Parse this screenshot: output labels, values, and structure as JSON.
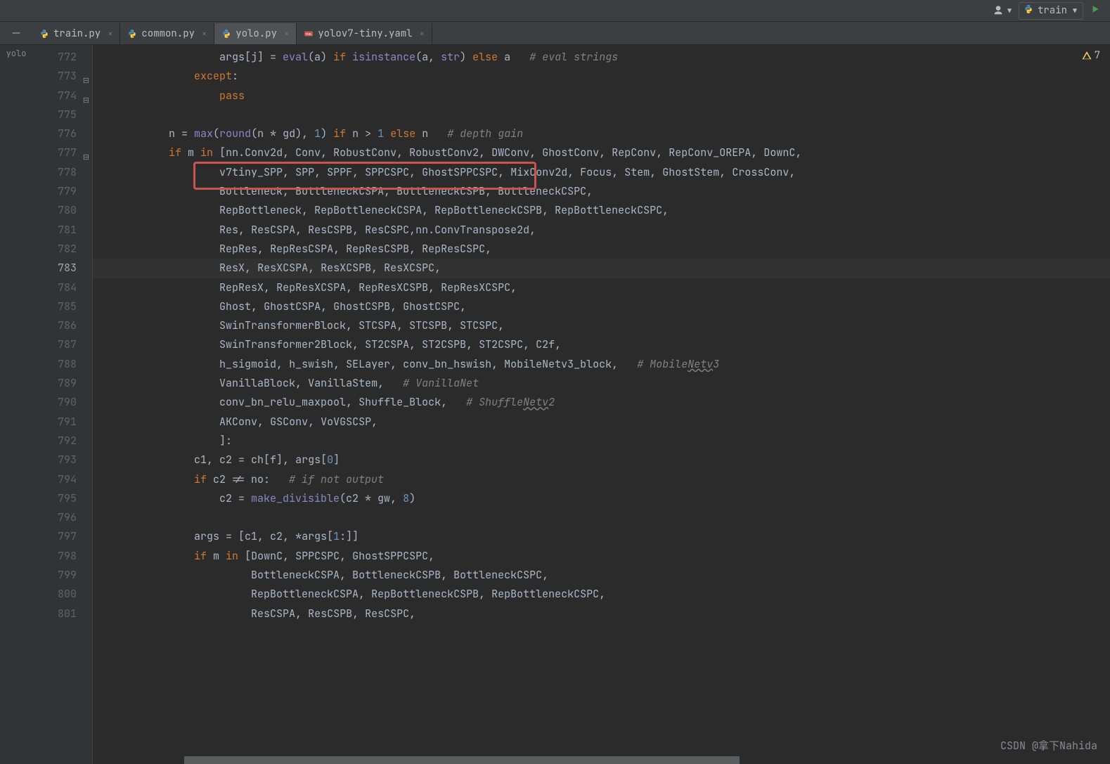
{
  "toolbar": {
    "run_config": "train"
  },
  "tabs": [
    {
      "name": "train.py",
      "icon": "py",
      "active": false
    },
    {
      "name": "common.py",
      "icon": "py",
      "active": false
    },
    {
      "name": "yolo.py",
      "icon": "py",
      "active": true
    },
    {
      "name": "yolov7-tiny.yaml",
      "icon": "yml",
      "active": false
    }
  ],
  "left_label": "yolo",
  "problems_count": "7",
  "watermark": "CSDN @拿下Nahida",
  "lines": [
    {
      "num": 772,
      "indent": 20,
      "spans": [
        [
          "gl",
          "args[j] = "
        ],
        [
          "bi",
          "eval"
        ],
        [
          "pn",
          "(a) "
        ],
        [
          "kw",
          "if "
        ],
        [
          "bi",
          "isinstance"
        ],
        [
          "pn",
          "(a"
        ],
        [
          "op",
          ", "
        ],
        [
          "bi",
          "str"
        ],
        [
          "pn",
          ") "
        ],
        [
          "kw",
          "else"
        ],
        [
          "pn",
          " a   "
        ],
        [
          "cm",
          "# eval strings"
        ]
      ]
    },
    {
      "num": 773,
      "indent": 16,
      "fold": "▾",
      "spans": [
        [
          "kw",
          "except"
        ],
        [
          "pn",
          ":"
        ]
      ]
    },
    {
      "num": 774,
      "indent": 20,
      "fold": "▴",
      "spans": [
        [
          "kw",
          "pass"
        ]
      ]
    },
    {
      "num": 775,
      "indent": 0,
      "spans": []
    },
    {
      "num": 776,
      "indent": 12,
      "spans": [
        [
          "gl",
          "n = "
        ],
        [
          "bi",
          "max"
        ],
        [
          "pn",
          "("
        ],
        [
          "bi",
          "round"
        ],
        [
          "pn",
          "(n * gd)"
        ],
        [
          "op",
          ", "
        ],
        [
          "nm",
          "1"
        ],
        [
          "pn",
          ") "
        ],
        [
          "kw",
          "if"
        ],
        [
          "pn",
          " n > "
        ],
        [
          "nm",
          "1"
        ],
        [
          "pn",
          " "
        ],
        [
          "kw",
          "else"
        ],
        [
          "pn",
          " n   "
        ],
        [
          "cm",
          "# depth gain"
        ]
      ]
    },
    {
      "num": 777,
      "indent": 12,
      "fold": "▾",
      "spans": [
        [
          "kw",
          "if"
        ],
        [
          "pn",
          " m "
        ],
        [
          "kw",
          "in"
        ],
        [
          "pn",
          " [nn.Conv2d"
        ],
        [
          "op",
          ", "
        ],
        [
          "cl",
          "Conv"
        ],
        [
          "op",
          ", "
        ],
        [
          "cl",
          "RobustConv"
        ],
        [
          "op",
          ", "
        ],
        [
          "cl",
          "RobustConv2"
        ],
        [
          "op",
          ", "
        ],
        [
          "cl",
          "DWConv"
        ],
        [
          "op",
          ", "
        ],
        [
          "cl",
          "GhostConv"
        ],
        [
          "op",
          ", "
        ],
        [
          "cl",
          "RepConv"
        ],
        [
          "op",
          ", "
        ],
        [
          "cl",
          "RepConv_OREPA"
        ],
        [
          "op",
          ", "
        ],
        [
          "cl",
          "DownC"
        ],
        [
          "op",
          ","
        ]
      ]
    },
    {
      "num": 778,
      "indent": 18,
      "spans": [
        [
          "pn",
          "  "
        ],
        [
          "cl",
          "v7tiny_SPP"
        ],
        [
          "op",
          ", "
        ],
        [
          "cl",
          "SPP"
        ],
        [
          "op",
          ", "
        ],
        [
          "cl",
          "SPPF"
        ],
        [
          "op",
          ", "
        ],
        [
          "cl",
          "SPPCSPC"
        ],
        [
          "op",
          ", "
        ],
        [
          "cl",
          "GhostSPPCSPC"
        ],
        [
          "op",
          ", "
        ],
        [
          "cl",
          "MixConv2d"
        ],
        [
          "op",
          ", "
        ],
        [
          "cl",
          "Focus"
        ],
        [
          "op",
          ", "
        ],
        [
          "cl",
          "Stem"
        ],
        [
          "op",
          ", "
        ],
        [
          "cl",
          "GhostStem"
        ],
        [
          "op",
          ", "
        ],
        [
          "cl",
          "CrossConv"
        ],
        [
          "op",
          ","
        ]
      ]
    },
    {
      "num": 779,
      "indent": 18,
      "spans": [
        [
          "pn",
          "  "
        ],
        [
          "cl",
          "Bottleneck"
        ],
        [
          "op",
          ", "
        ],
        [
          "cl",
          "BottleneckCSPA"
        ],
        [
          "op",
          ", "
        ],
        [
          "cl",
          "BottleneckCSPB"
        ],
        [
          "op",
          ", "
        ],
        [
          "cl",
          "BottleneckCSPC"
        ],
        [
          "op",
          ","
        ]
      ]
    },
    {
      "num": 780,
      "indent": 18,
      "spans": [
        [
          "pn",
          "  "
        ],
        [
          "cl",
          "RepBottleneck"
        ],
        [
          "op",
          ", "
        ],
        [
          "cl",
          "RepBottleneckCSPA"
        ],
        [
          "op",
          ", "
        ],
        [
          "cl",
          "RepBottleneckCSPB"
        ],
        [
          "op",
          ", "
        ],
        [
          "cl",
          "RepBottleneckCSPC"
        ],
        [
          "op",
          ","
        ]
      ]
    },
    {
      "num": 781,
      "indent": 18,
      "spans": [
        [
          "pn",
          "  "
        ],
        [
          "cl",
          "Res"
        ],
        [
          "op",
          ", "
        ],
        [
          "cl",
          "ResCSPA"
        ],
        [
          "op",
          ", "
        ],
        [
          "cl",
          "ResCSPB"
        ],
        [
          "op",
          ", "
        ],
        [
          "cl",
          "ResCSPC"
        ],
        [
          "op",
          ","
        ],
        [
          "cl",
          "nn.ConvTranspose2d"
        ],
        [
          "op",
          ","
        ]
      ]
    },
    {
      "num": 782,
      "indent": 18,
      "spans": [
        [
          "pn",
          "  "
        ],
        [
          "cl",
          "RepRes"
        ],
        [
          "op",
          ", "
        ],
        [
          "cl",
          "RepResCSPA"
        ],
        [
          "op",
          ", "
        ],
        [
          "cl",
          "RepResCSPB"
        ],
        [
          "op",
          ", "
        ],
        [
          "cl",
          "RepResCSPC"
        ],
        [
          "op",
          ","
        ]
      ]
    },
    {
      "num": 783,
      "indent": 18,
      "current": true,
      "bulb": true,
      "spans": [
        [
          "pn",
          "  "
        ],
        [
          "cl",
          "ResX"
        ],
        [
          "op",
          ", "
        ],
        [
          "cl",
          "ResXCSPA"
        ],
        [
          "op",
          ", "
        ],
        [
          "cl",
          "ResXCSPB"
        ],
        [
          "op",
          ", "
        ],
        [
          "cl",
          "ResXCSPC"
        ],
        [
          "op",
          ","
        ]
      ]
    },
    {
      "num": 784,
      "indent": 18,
      "spans": [
        [
          "pn",
          "  "
        ],
        [
          "cl",
          "RepResX"
        ],
        [
          "op",
          ", "
        ],
        [
          "cl",
          "RepResXCSPA"
        ],
        [
          "op",
          ", "
        ],
        [
          "cl",
          "RepResXCSPB"
        ],
        [
          "op",
          ", "
        ],
        [
          "cl",
          "RepResXCSPC"
        ],
        [
          "op",
          ","
        ]
      ]
    },
    {
      "num": 785,
      "indent": 18,
      "spans": [
        [
          "pn",
          "  "
        ],
        [
          "cl",
          "Ghost"
        ],
        [
          "op",
          ", "
        ],
        [
          "cl",
          "GhostCSPA"
        ],
        [
          "op",
          ", "
        ],
        [
          "cl",
          "GhostCSPB"
        ],
        [
          "op",
          ", "
        ],
        [
          "cl",
          "GhostCSPC"
        ],
        [
          "op",
          ","
        ]
      ]
    },
    {
      "num": 786,
      "indent": 18,
      "spans": [
        [
          "pn",
          "  "
        ],
        [
          "cl",
          "SwinTransformerBlock"
        ],
        [
          "op",
          ", "
        ],
        [
          "cl",
          "STCSPA"
        ],
        [
          "op",
          ", "
        ],
        [
          "cl",
          "STCSPB"
        ],
        [
          "op",
          ", "
        ],
        [
          "cl",
          "STCSPC"
        ],
        [
          "op",
          ","
        ]
      ]
    },
    {
      "num": 787,
      "indent": 18,
      "spans": [
        [
          "pn",
          "  "
        ],
        [
          "cl",
          "SwinTransformer2Block"
        ],
        [
          "op",
          ", "
        ],
        [
          "cl",
          "ST2CSPA"
        ],
        [
          "op",
          ", "
        ],
        [
          "cl",
          "ST2CSPB"
        ],
        [
          "op",
          ", "
        ],
        [
          "cl",
          "ST2CSPC"
        ],
        [
          "op",
          ", "
        ],
        [
          "cl",
          "C2f"
        ],
        [
          "op",
          ","
        ]
      ]
    },
    {
      "num": 788,
      "indent": 18,
      "spans": [
        [
          "pn",
          "  "
        ],
        [
          "cl",
          "h_sigmoid"
        ],
        [
          "op",
          ", "
        ],
        [
          "cl",
          "h_swish"
        ],
        [
          "op",
          ", "
        ],
        [
          "cl",
          "SELayer"
        ],
        [
          "op",
          ", "
        ],
        [
          "cl",
          "conv_bn_hswish"
        ],
        [
          "op",
          ", "
        ],
        [
          "cl",
          "MobileNetv3_block"
        ],
        [
          "op",
          ",   "
        ],
        [
          "cm",
          "# Mobile"
        ],
        [
          "cm und",
          "Netv"
        ],
        [
          "cm",
          "3"
        ]
      ]
    },
    {
      "num": 789,
      "indent": 18,
      "spans": [
        [
          "pn",
          "  "
        ],
        [
          "cl",
          "VanillaBlock"
        ],
        [
          "op",
          ", "
        ],
        [
          "cl",
          "VanillaStem"
        ],
        [
          "op",
          ",   "
        ],
        [
          "cm",
          "# VanillaNet"
        ]
      ]
    },
    {
      "num": 790,
      "indent": 18,
      "spans": [
        [
          "pn",
          "  "
        ],
        [
          "cl",
          "conv_bn_relu_maxpool"
        ],
        [
          "op",
          ", "
        ],
        [
          "cl",
          "Shuffle_Block"
        ],
        [
          "op",
          ",   "
        ],
        [
          "cm",
          "# Shuffle"
        ],
        [
          "cm und",
          "Netv"
        ],
        [
          "cm",
          "2"
        ]
      ]
    },
    {
      "num": 791,
      "indent": 18,
      "spans": [
        [
          "pn",
          "  "
        ],
        [
          "cl",
          "AKConv"
        ],
        [
          "op",
          ", "
        ],
        [
          "cl",
          "GSConv"
        ],
        [
          "op",
          ", "
        ],
        [
          "cl",
          "VoVGSCSP"
        ],
        [
          "op",
          ","
        ]
      ]
    },
    {
      "num": 792,
      "indent": 18,
      "spans": [
        [
          "pn",
          "  ]:"
        ]
      ]
    },
    {
      "num": 793,
      "indent": 16,
      "spans": [
        [
          "gl",
          "c1"
        ],
        [
          "op",
          ", "
        ],
        [
          "gl",
          "c2 = ch[f]"
        ],
        [
          "op",
          ", "
        ],
        [
          "gl",
          "args["
        ],
        [
          "nm",
          "0"
        ],
        [
          "gl",
          "]"
        ]
      ]
    },
    {
      "num": 794,
      "indent": 16,
      "spans": [
        [
          "kw",
          "if"
        ],
        [
          "pn",
          " c2 != no:   "
        ],
        [
          "cm",
          "# if not output"
        ]
      ]
    },
    {
      "num": 795,
      "indent": 20,
      "spans": [
        [
          "gl",
          "c2 = "
        ],
        [
          "fn",
          "make_divisible"
        ],
        [
          "pn",
          "(c2 * gw"
        ],
        [
          "op",
          ", "
        ],
        [
          "nm",
          "8"
        ],
        [
          "pn",
          ")"
        ]
      ]
    },
    {
      "num": 796,
      "indent": 0,
      "spans": []
    },
    {
      "num": 797,
      "indent": 16,
      "spans": [
        [
          "gl",
          "args = [c1"
        ],
        [
          "op",
          ", "
        ],
        [
          "gl",
          "c2"
        ],
        [
          "op",
          ", "
        ],
        [
          "gl",
          "*args["
        ],
        [
          "nm",
          "1"
        ],
        [
          "gl",
          ":]]"
        ]
      ]
    },
    {
      "num": 798,
      "indent": 16,
      "spans": [
        [
          "kw",
          "if"
        ],
        [
          "pn",
          " m "
        ],
        [
          "kw",
          "in"
        ],
        [
          "pn",
          " [DownC"
        ],
        [
          "op",
          ", "
        ],
        [
          "cl",
          "SPPCSPC"
        ],
        [
          "op",
          ", "
        ],
        [
          "cl",
          "GhostSPPCSPC"
        ],
        [
          "op",
          ","
        ]
      ]
    },
    {
      "num": 799,
      "indent": 24,
      "spans": [
        [
          "pn",
          " "
        ],
        [
          "cl",
          "BottleneckCSPA"
        ],
        [
          "op",
          ", "
        ],
        [
          "cl",
          "BottleneckCSPB"
        ],
        [
          "op",
          ", "
        ],
        [
          "cl",
          "BottleneckCSPC"
        ],
        [
          "op",
          ","
        ]
      ]
    },
    {
      "num": 800,
      "indent": 24,
      "spans": [
        [
          "pn",
          " "
        ],
        [
          "cl",
          "RepBottleneckCSPA"
        ],
        [
          "op",
          ", "
        ],
        [
          "cl",
          "RepBottleneckCSPB"
        ],
        [
          "op",
          ", "
        ],
        [
          "cl",
          "RepBottleneckCSPC"
        ],
        [
          "op",
          ","
        ]
      ]
    },
    {
      "num": 801,
      "indent": 24,
      "spans": [
        [
          "pn",
          " "
        ],
        [
          "cl",
          "ResCSPA"
        ],
        [
          "op",
          ", "
        ],
        [
          "cl",
          "ResCSPB"
        ],
        [
          "op",
          ", "
        ],
        [
          "cl",
          "ResCSPC"
        ],
        [
          "op",
          ","
        ]
      ]
    }
  ]
}
